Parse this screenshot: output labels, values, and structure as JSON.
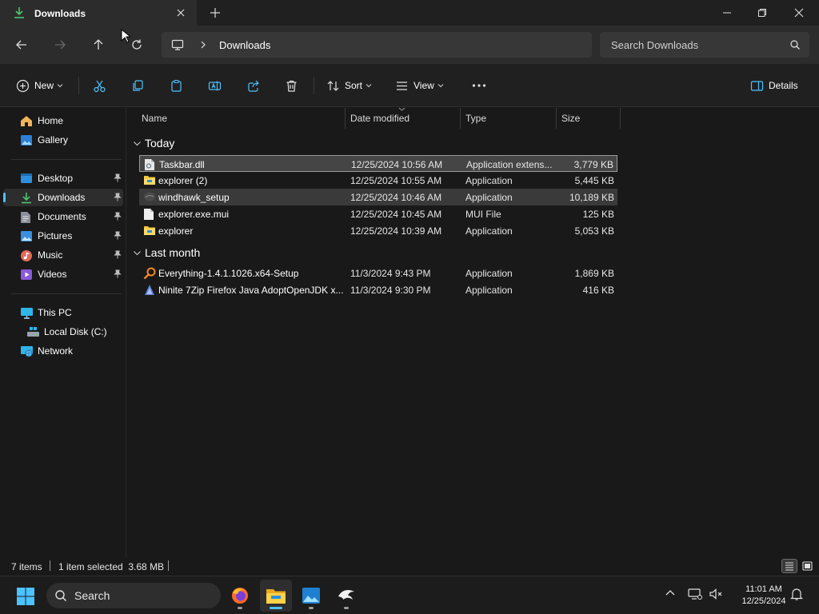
{
  "window": {
    "tab_title": "Downloads"
  },
  "address": {
    "crumb": "Downloads",
    "search_placeholder": "Search Downloads"
  },
  "toolbar": {
    "new_label": "New",
    "sort_label": "Sort",
    "view_label": "View",
    "details_label": "Details"
  },
  "sidebar": {
    "home": "Home",
    "gallery": "Gallery",
    "desktop": "Desktop",
    "downloads": "Downloads",
    "documents": "Documents",
    "pictures": "Pictures",
    "music": "Music",
    "videos": "Videos",
    "this_pc": "This PC",
    "local_disk": "Local Disk (C:)",
    "network": "Network"
  },
  "columns": {
    "name": "Name",
    "date": "Date modified",
    "type": "Type",
    "size": "Size"
  },
  "groups": {
    "today": "Today",
    "last_month": "Last month"
  },
  "files": [
    {
      "name": "Taskbar.dll",
      "date": "12/25/2024 10:56 AM",
      "type": "Application extens...",
      "size": "3,779 KB",
      "icon": "dll-file-icon"
    },
    {
      "name": "explorer (2)",
      "date": "12/25/2024 10:55 AM",
      "type": "Application",
      "size": "5,445 KB",
      "icon": "explorer-app-icon"
    },
    {
      "name": "windhawk_setup",
      "date": "12/25/2024 10:46 AM",
      "type": "Application",
      "size": "10,189 KB",
      "icon": "windhawk-app-icon"
    },
    {
      "name": "explorer.exe.mui",
      "date": "12/25/2024 10:45 AM",
      "type": "MUI File",
      "size": "125 KB",
      "icon": "blank-file-icon"
    },
    {
      "name": "explorer",
      "date": "12/25/2024 10:39 AM",
      "type": "Application",
      "size": "5,053 KB",
      "icon": "explorer-app-icon"
    },
    {
      "name": "Everything-1.4.1.1026.x64-Setup",
      "date": "11/3/2024 9:43 PM",
      "type": "Application",
      "size": "1,869 KB",
      "icon": "everything-app-icon"
    },
    {
      "name": "Ninite 7Zip Firefox Java AdoptOpenJDK x...",
      "date": "11/3/2024 9:30 PM",
      "type": "Application",
      "size": "416 KB",
      "icon": "ninite-app-icon"
    }
  ],
  "status": {
    "count": "7 items",
    "selection": "1 item selected  3.68 MB"
  },
  "taskbar": {
    "search_label": "Search",
    "time": "11:01 AM",
    "date": "12/25/2024"
  },
  "colors": {
    "accent": "#4cc2ff",
    "folder": "#f4c542",
    "background": "#191919"
  }
}
